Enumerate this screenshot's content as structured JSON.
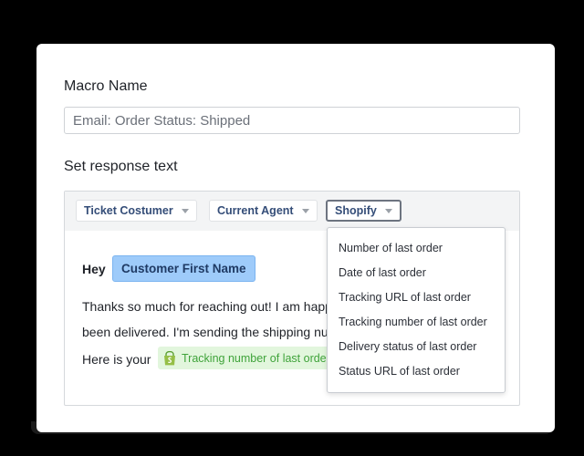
{
  "form": {
    "macro_name_label": "Macro Name",
    "macro_name_value": "Email: Order Status: Shipped",
    "response_label": "Set response text"
  },
  "toolbar": {
    "buttons": [
      {
        "label": "Ticket Costumer"
      },
      {
        "label": "Current Agent"
      },
      {
        "label": "Shopify"
      }
    ]
  },
  "editor": {
    "greeting": "Hey",
    "customer_variable": "Customer First Name",
    "line1": "Thanks so much for reaching out! I am happ",
    "line2": "been delivered. I'm sending the shipping nu",
    "line3_prefix": "Here is your",
    "tracking_variable": "Tracking number of last order"
  },
  "dropdown": {
    "items": [
      "Number of last order",
      "Date of last order",
      "Tracking URL of last order",
      "Tracking number of last order",
      "Delivery status of last order",
      "Status URL of last order"
    ]
  },
  "colors": {
    "customer_pill": "#9ecbfa",
    "tracking_pill": "#e2f6dd",
    "tracking_text": "#3fa33a",
    "toolbar_text": "#344d78"
  }
}
